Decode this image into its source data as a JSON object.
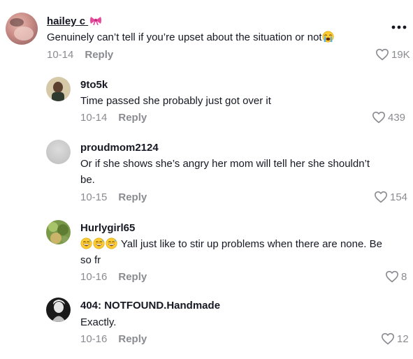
{
  "comments": [
    {
      "username": "hailey c",
      "name_emoji_icon": "bow-icon",
      "text": "Genuinely can’t tell if you’re upset about the situation or not",
      "text_emoji_icon": "loudly-crying-face-icon",
      "date": "10-14",
      "reply_label": "Reply",
      "likes": "19K"
    },
    {
      "username": "9to5k",
      "text": "Time passed she probably just got over it",
      "date": "10-14",
      "reply_label": "Reply",
      "likes": "439"
    },
    {
      "username": "proudmom2124",
      "text_line1": "Or if she shows she’s angry her mom will tell her she shouldn’t",
      "text_line2": "be.",
      "date": "10-15",
      "reply_label": "Reply",
      "likes": "154"
    },
    {
      "username": "Hurlygirl65",
      "text_emoji_icons": [
        "grinning-sweat-face-icon",
        "grinning-sweat-face-icon",
        "grinning-sweat-face-icon"
      ],
      "text_line1": "Yall just like to stir up problems when there are none. Be",
      "text_line2": "so fr",
      "date": "10-16",
      "reply_label": "Reply",
      "likes": "8"
    },
    {
      "username": "404: NOTFOUND.Handmade",
      "text": "Exactly.",
      "date": "10-16",
      "reply_label": "Reply",
      "likes": "12"
    }
  ],
  "more_icon": "more-options-icon",
  "like_icon": "heart-outline-icon",
  "colors": {
    "text": "#161823",
    "muted": "#8a8b91",
    "background": "#ffffff"
  }
}
